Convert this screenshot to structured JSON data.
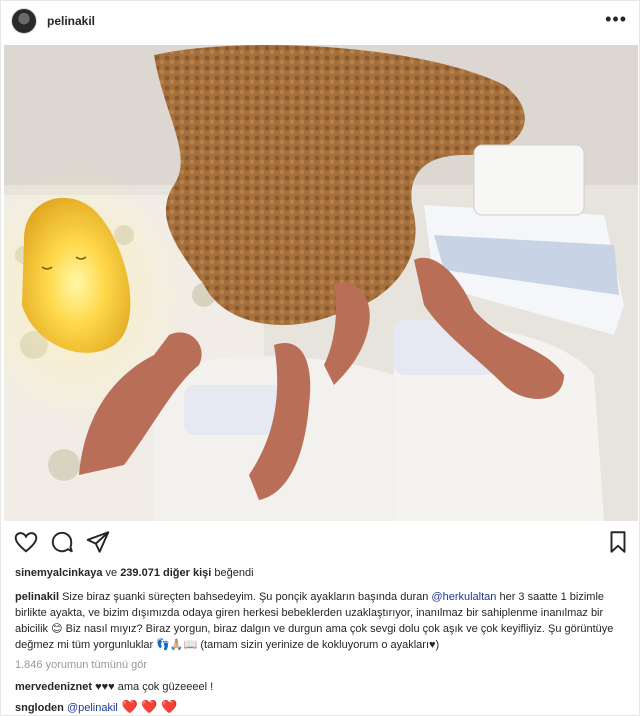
{
  "header": {
    "username": "pelinakil",
    "more_icon": "ellipsis-icon"
  },
  "post": {
    "image_icon": "photo-twin-babies-dog-night-lamp",
    "actions": {
      "like_icon": "heart-outline-icon",
      "comment_icon": "comment-bubble-icon",
      "share_icon": "paper-plane-icon",
      "save_icon": "bookmark-icon"
    },
    "likes": {
      "first_user": "sinemyalcinkaya",
      "middle": " ve ",
      "count": "239.071 diğer kişi",
      "suffix": " beğendi"
    },
    "caption": {
      "author": "pelinakil",
      "part1": " Size biraz şuanki süreçten bahsedeyim. Şu ponçik ayakların başında duran ",
      "mention": "@herkulaltan",
      "part2": " her 3 saatte 1 bizimle birlikte ayakta, ve bizim dışımızda odaya giren herkesi bebeklerden uzaklaştırıyor, inanılmaz bir sahiplenme inanılmaz bir abicilik ",
      "emoji1": "😊",
      "part3": " Biz nasıl mıyız? Biraz yorgun, biraz dalgın ve durgun ama çok sevgi dolu çok aşık ve çok keyifliyiz. Şu görüntüye değmez mi tüm yorgunluklar ",
      "emoji2": "👣🙏🏼📖",
      "part4": " (tamam sizin yerinize de kokluyorum o ayakları♥)"
    },
    "view_all_comments": "1.846 yorumun tümünü gör",
    "comments": [
      {
        "user": "mervedeniznet",
        "text": " ♥♥♥ ama çok güzeeeel !"
      },
      {
        "user": "sngloden",
        "mention": " @pelinakil",
        "hearts": " ❤️ ❤️ ❤️"
      }
    ]
  },
  "colors": {
    "text": "#262626",
    "mention": "#1f3a93",
    "muted": "#999999",
    "heart": "#e0245e",
    "lamp_glow": "#ffd84a"
  }
}
